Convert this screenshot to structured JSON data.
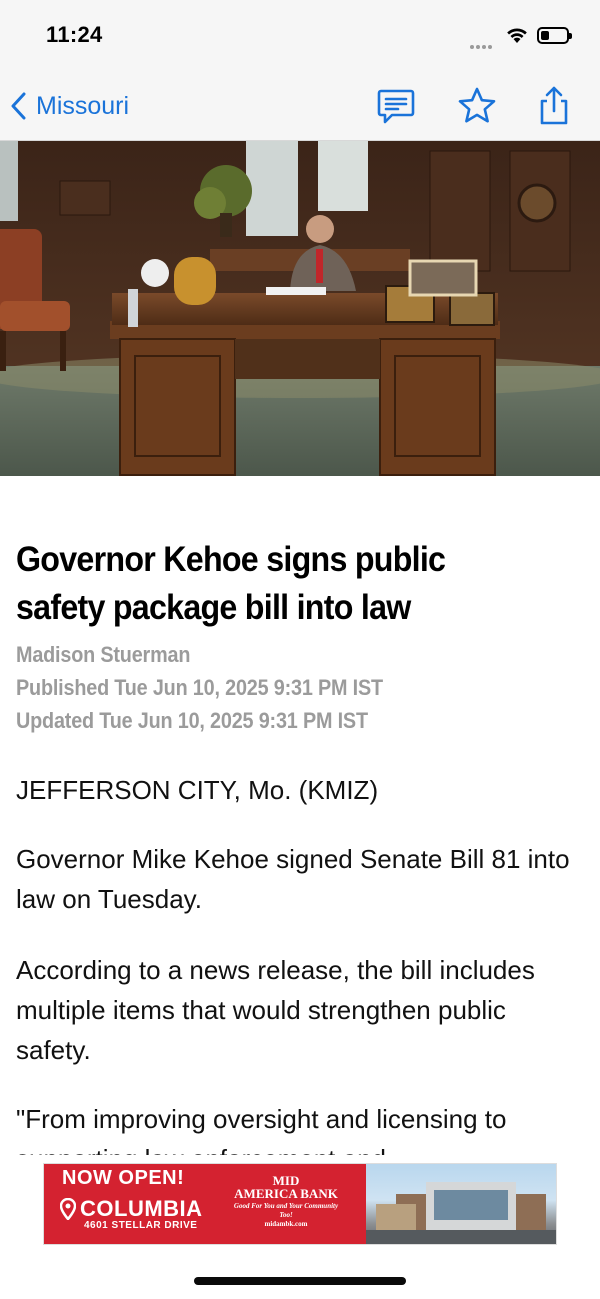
{
  "status": {
    "time": "11:24"
  },
  "nav": {
    "back_label": "Missouri",
    "icons": [
      "comment-icon",
      "star-icon",
      "share-icon"
    ],
    "accent_color": "#1a73d9"
  },
  "article": {
    "headline": "Governor Kehoe signs public safety package bill into law",
    "author": "Madison Stuerman",
    "published": "Published Tue Jun 10, 2025 9:31 PM IST",
    "updated": "Updated Tue Jun 10, 2025 9:31 PM IST",
    "paragraphs": [
      "JEFFERSON CITY, Mo. (KMIZ)",
      "Governor Mike Kehoe signed Senate Bill 81 into law on Tuesday.",
      "According to a news release, the bill includes multiple items that would strengthen public safety.",
      "\"From improving oversight and licensing to supporting law enforcement and"
    ]
  },
  "ad": {
    "headline": "NOW OPEN!",
    "city": "COLUMBIA",
    "address": "4601 STELLAR DRIVE",
    "bank_line1": "MID",
    "bank_line2": "AMERICA BANK",
    "bank_tagline": "Good For You and Your Community Too!",
    "bank_url": "midambk.com",
    "ad_color": "#d42230"
  }
}
